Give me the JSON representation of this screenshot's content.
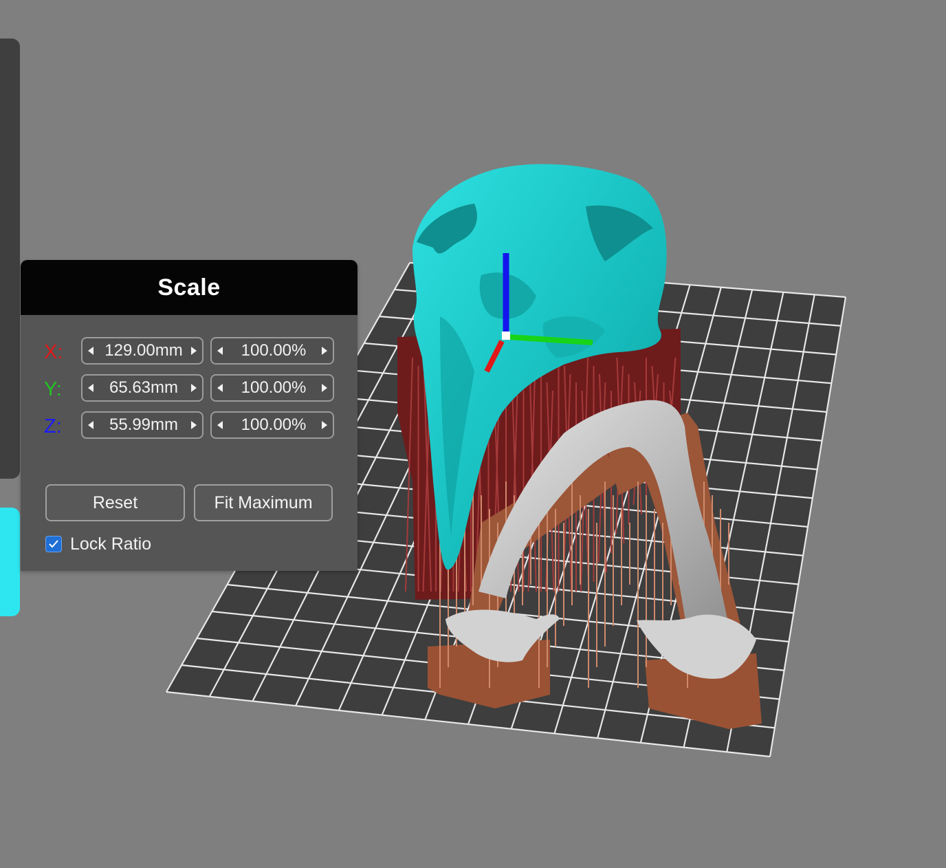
{
  "scale_panel": {
    "title": "Scale",
    "rows": [
      {
        "axis": "X:",
        "mm": "129.00mm",
        "percent": "100.00%"
      },
      {
        "axis": "Y:",
        "mm": "65.63mm",
        "percent": "100.00%"
      },
      {
        "axis": "Z:",
        "mm": "55.99mm",
        "percent": "100.00%"
      }
    ],
    "reset_label": "Reset",
    "fit_label": "Fit Maximum",
    "lock_label": "Lock Ratio",
    "lock_checked": true
  },
  "colors": {
    "axis_x": "#e01818",
    "axis_y": "#18c418",
    "axis_z": "#1a1aff",
    "model_teal": "#19c8c8",
    "support_dark_red": "#7a1f1f",
    "support_brown": "#9a5436",
    "jaw_gray": "#bdbdbd",
    "build_plate": "#3d3d3d",
    "toolbar_cyan": "#2ee6f0"
  },
  "icons": [
    "check-icon",
    "arrow-left-icon",
    "arrow-right-icon"
  ]
}
